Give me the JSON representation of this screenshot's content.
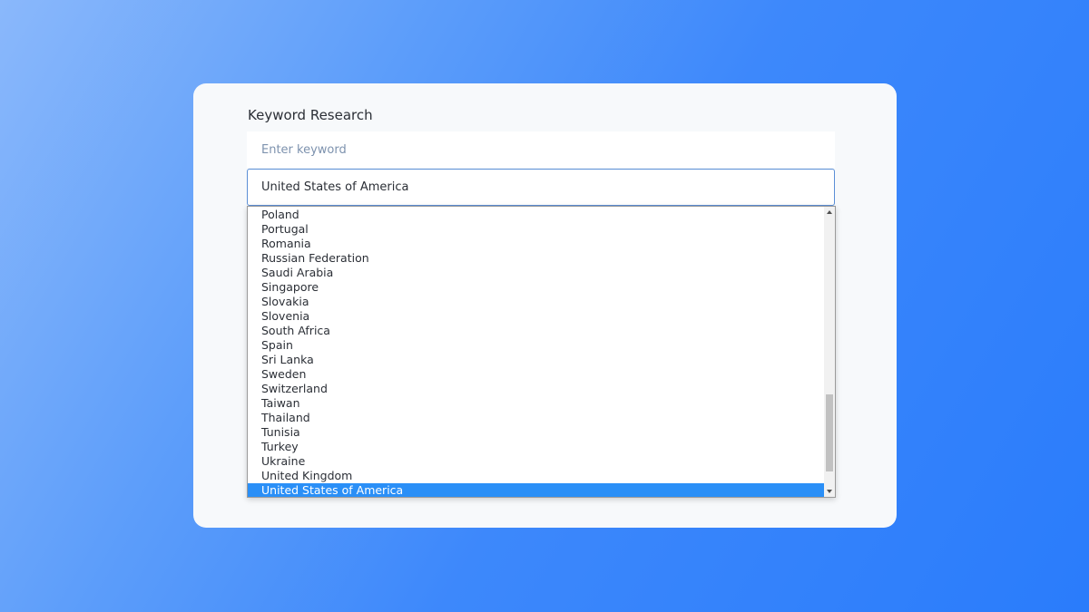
{
  "form": {
    "title": "Keyword Research",
    "keyword_placeholder": "Enter keyword",
    "country_selected": "United States of America"
  },
  "dropdown": {
    "options": [
      "Poland",
      "Portugal",
      "Romania",
      "Russian Federation",
      "Saudi Arabia",
      "Singapore",
      "Slovakia",
      "Slovenia",
      "South Africa",
      "Spain",
      "Sri Lanka",
      "Sweden",
      "Switzerland",
      "Taiwan",
      "Thailand",
      "Tunisia",
      "Turkey",
      "Ukraine",
      "United Kingdom",
      "United States of America"
    ],
    "highlighted": "United States of America"
  },
  "colors": {
    "accent": "#2a8ff7",
    "select_border": "#5b8fd6",
    "card_background": "#f7f9fb"
  },
  "icons": {
    "scroll_up": "triangle-up-icon",
    "scroll_down": "triangle-down-icon"
  }
}
